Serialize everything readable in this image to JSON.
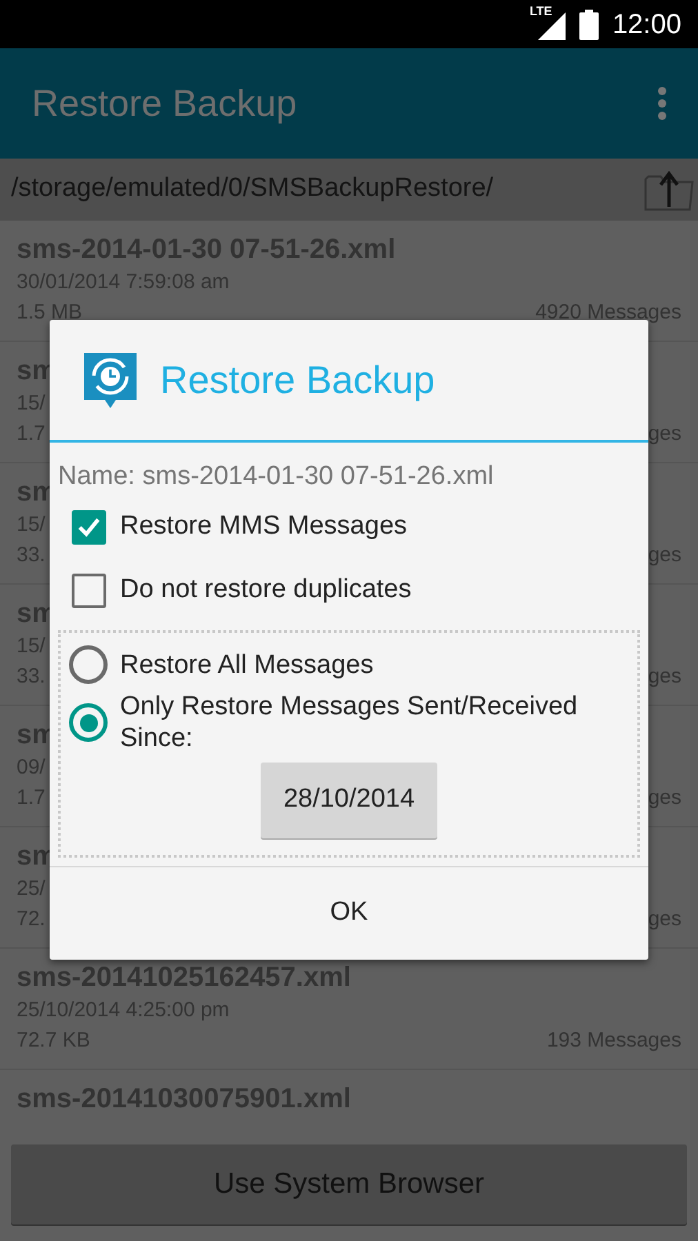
{
  "status_bar": {
    "network": "LTE",
    "time": "12:00"
  },
  "app_bar": {
    "title": "Restore Backup"
  },
  "path": "/storage/emulated/0/SMSBackupRestore/",
  "backups": [
    {
      "name": "sms-2014-01-30 07-51-26.xml",
      "date": "30/01/2014 7:59:08 am",
      "size": "1.5 MB",
      "count": "4920 Messages"
    },
    {
      "name": "sm",
      "date": "15/",
      "size": "1.7",
      "count": "ges"
    },
    {
      "name": "sm",
      "date": "15/",
      "size": "33.",
      "count": "ges"
    },
    {
      "name": "sm",
      "date": "15/",
      "size": "33.",
      "count": "ges"
    },
    {
      "name": "sm",
      "date": "09/",
      "size": "1.7",
      "count": "ges"
    },
    {
      "name": "sm",
      "date": "25/",
      "size": "72.",
      "count": "ges"
    },
    {
      "name": "sms-20141025162457.xml",
      "date": "25/10/2014 4:25:00 pm",
      "size": "72.7 KB",
      "count": "193 Messages"
    },
    {
      "name": "sms-20141030075901.xml"
    }
  ],
  "system_browser_button": "Use System Browser",
  "dialog": {
    "title": "Restore Backup",
    "name_label": "Name: sms-2014-01-30 07-51-26.xml",
    "options": [
      {
        "kind": "checkbox",
        "label": "Restore MMS Messages",
        "checked": true
      },
      {
        "kind": "checkbox",
        "label": "Do not restore duplicates",
        "checked": false
      }
    ],
    "range_options": [
      {
        "label": "Restore All Messages",
        "selected": false
      },
      {
        "label": "Only Restore Messages Sent/Received Since:",
        "selected": true
      }
    ],
    "date_button": "28/10/2014",
    "ok_button": "OK"
  }
}
